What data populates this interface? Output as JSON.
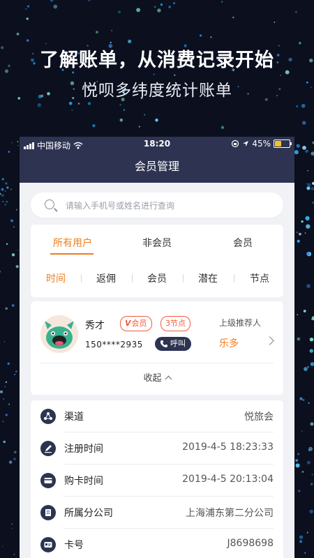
{
  "promo": {
    "headline": "了解账单，从消费记录开始",
    "subheadline": "悦呗多纬度统计账单"
  },
  "status_bar": {
    "carrier": "中国移动",
    "time": "18:20",
    "battery": "45%",
    "battery_level": 0.45
  },
  "nav": {
    "title": "会员管理"
  },
  "search": {
    "placeholder": "请输入手机号或姓名进行查询",
    "value": ""
  },
  "tabs": [
    {
      "label": "所有用户",
      "active": true
    },
    {
      "label": "非会员",
      "active": false
    },
    {
      "label": "会员",
      "active": false
    }
  ],
  "filters": [
    {
      "label": "时间",
      "active": true
    },
    {
      "label": "返佣",
      "active": false
    },
    {
      "label": "会员",
      "active": false
    },
    {
      "label": "潜在",
      "active": false
    },
    {
      "label": "节点",
      "active": false
    }
  ],
  "member": {
    "name": "秀才",
    "badge_vip": "会员",
    "badge_vip_mark": "V",
    "badge_nodes": "3节点",
    "phone": "150****2935",
    "call_label": "呼叫",
    "referrer_label": "上级推荐人",
    "referrer_name": "乐多",
    "collapse_label": "收起"
  },
  "details": [
    {
      "label": "渠道",
      "value": "悦旅会",
      "icon": "channel-icon"
    },
    {
      "label": "注册时间",
      "value": "2019-4-5 18:23:33",
      "icon": "pen-icon"
    },
    {
      "label": "购卡时间",
      "value": "2019-4-5 20:13:04",
      "icon": "card-icon"
    },
    {
      "label": "所属分公司",
      "value": "上海浦东第二分公司",
      "icon": "building-icon"
    },
    {
      "label": "卡号",
      "value": "J8698698",
      "icon": "id-card-icon"
    }
  ],
  "colors": {
    "accent": "#ef7d1a",
    "navy": "#2d3350",
    "badge_red": "#ef5b3b",
    "background": "#0b0f1e"
  }
}
